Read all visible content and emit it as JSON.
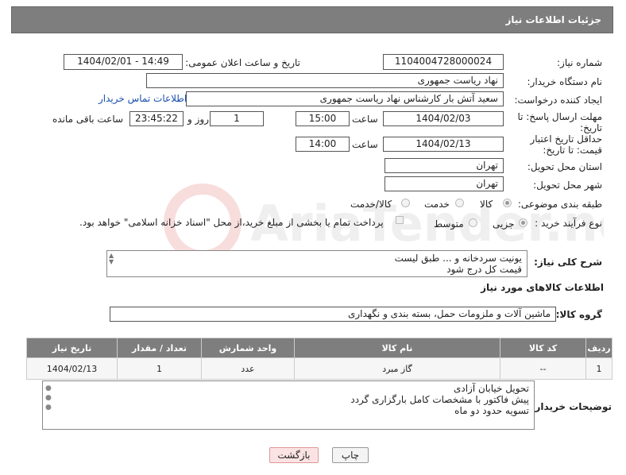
{
  "header": {
    "title": "جزئیات اطلاعات نیاز"
  },
  "fields": {
    "need_number_label": "شماره نیاز:",
    "need_number": "1104004728000024",
    "announce_label": "تاریخ و ساعت اعلان عمومی:",
    "announce_value": "1404/02/01 - 14:49",
    "buyer_org_label": "نام دستگاه خریدار:",
    "buyer_org": "نهاد ریاست جمهوری",
    "creator_label": "ایجاد کننده درخواست:",
    "creator": "سعید آتش بار کارشناس نهاد ریاست جمهوری",
    "contact_link": "اطلاعات تماس خریدار",
    "deadline_label": "مهلت ارسال پاسخ: تا تاریخ:",
    "deadline_date": "1404/02/03",
    "time_word": "ساعت",
    "deadline_time": "15:00",
    "days_value": "1",
    "days_word": "روز و",
    "remaining_time": "23:45:22",
    "remaining_word": "ساعت باقی مانده",
    "validity_label": "حداقل تاریخ اعتبار قیمت: تا تاریخ:",
    "validity_date": "1404/02/13",
    "validity_time": "14:00",
    "province_label": "استان محل تحویل:",
    "province": "تهران",
    "city_label": "شهر محل تحویل:",
    "city": "تهران",
    "category_label": "طبقه بندی موضوعی:",
    "category_options": [
      "کالا",
      "خدمت",
      "کالا/خدمت"
    ],
    "process_label": "نوع فرآیند خرید :",
    "process_options": [
      "جزیی",
      "متوسط"
    ],
    "payment_note": "پرداخت تمام یا بخشی از مبلغ خرید،از محل \"اسناد خزانه اسلامی\" خواهد بود."
  },
  "description": {
    "label": "شرح کلی نیاز:",
    "lines": [
      "یونیت سردخانه و ... طبق لیست",
      "قیمت کل درج شود"
    ]
  },
  "goods": {
    "section_title": "اطلاعات کالاهای مورد نیاز",
    "group_label": "گروه کالا:",
    "group_value": "ماشین آلات و ملزومات حمل، بسته بندی و نگهداری",
    "headers": [
      "ردیف",
      "کد کالا",
      "نام کالا",
      "واحد شمارش",
      "تعداد / مقدار",
      "تاریخ نیاز"
    ],
    "rows": [
      [
        "1",
        "--",
        "گاز مبرد",
        "عدد",
        "1",
        "1404/02/13"
      ]
    ]
  },
  "buyer_notes": {
    "label": "توضیحات خریدار:",
    "lines": [
      "تحویل خیابان آزادی",
      "پیش فاکتور با مشخصات کامل بارگزاری گردد",
      "تسویه حدود دو ماه"
    ]
  },
  "buttons": {
    "print": "چاپ",
    "back": "بازگشت"
  },
  "watermark_text": "AriaTender.neT"
}
